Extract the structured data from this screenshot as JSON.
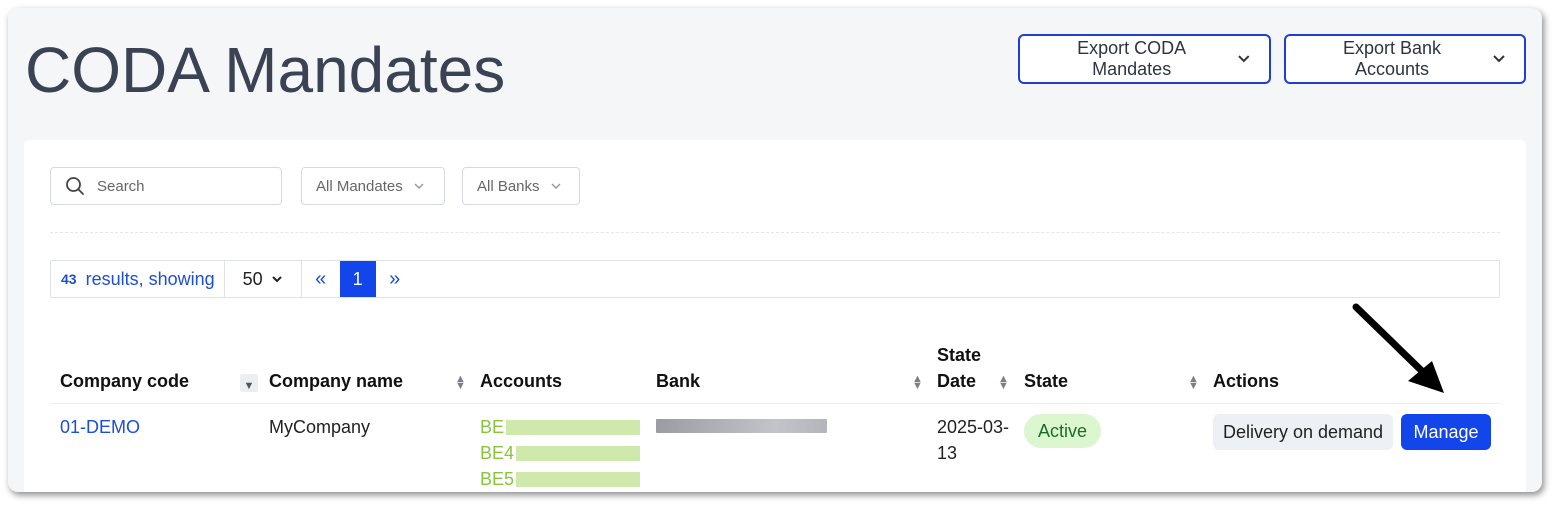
{
  "header": {
    "title": "CODA Mandates",
    "export_mandates_label": "Export CODA Mandates",
    "export_accounts_label": "Export Bank Accounts"
  },
  "filters": {
    "search_placeholder": "Search",
    "mandates_label": "All Mandates",
    "banks_label": "All Banks"
  },
  "pagination": {
    "count": "43",
    "results_label": "results, showing",
    "per_page": "50",
    "first_icon": "«",
    "current_page": "1",
    "last_icon": "»"
  },
  "table": {
    "columns": {
      "company_code": "Company code",
      "company_name": "Company name",
      "accounts": "Accounts",
      "bank": "Bank",
      "state_date_line1": "State",
      "state_date_line2": "Date",
      "state": "State",
      "actions": "Actions"
    },
    "rows": [
      {
        "company_code": "01-DEMO",
        "company_name": "MyCompany",
        "accounts": [
          "BE",
          "BE4",
          "BE5"
        ],
        "state_date_line1": "2025-03-",
        "state_date_line2": "13",
        "state": "Active",
        "action_delivery": "Delivery on demand",
        "action_manage": "Manage"
      }
    ]
  },
  "icons": {
    "search": "search-icon",
    "chevron": "chevron-down-icon",
    "sort": "sort-icon",
    "arrow": "arrow-annotation-icon"
  },
  "colors": {
    "primary": "#1346ea",
    "title": "#3a4254",
    "active_badge_bg": "#dcf7cf",
    "account_text": "#8ac43e"
  }
}
